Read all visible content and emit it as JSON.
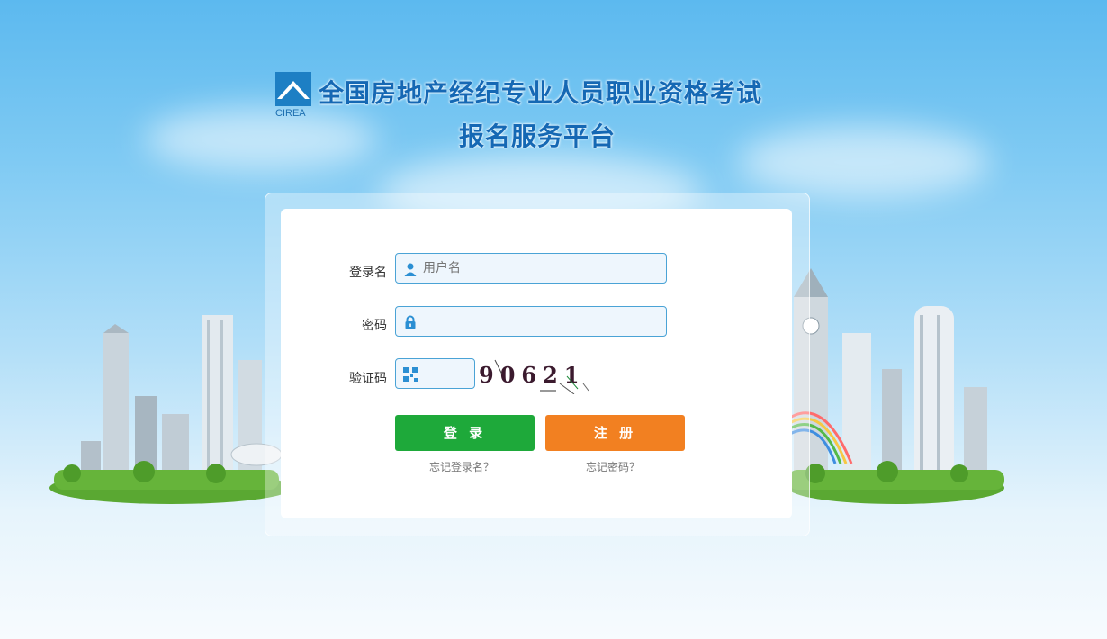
{
  "header": {
    "logo_text": "CIREA",
    "title_line1": "全国房地产经纪专业人员职业资格考试",
    "title_line2": "报名服务平台"
  },
  "form": {
    "username_label": "登录名",
    "username_placeholder": "用户名",
    "password_label": "密码",
    "password_placeholder": "",
    "captcha_label": "验证码",
    "captcha_value": "",
    "captcha_image_text": "90621",
    "login_button": "登 录",
    "register_button": "注 册",
    "forgot_username": "忘记登录名？",
    "forgot_password": "忘记密码？"
  },
  "icons": {
    "user": "user-icon",
    "lock": "lock-icon",
    "captcha": "qr-icon"
  },
  "colors": {
    "primary_blue": "#1568b4",
    "login_green": "#1ea93a",
    "register_orange": "#f28021",
    "field_border": "#4aa3d6"
  }
}
